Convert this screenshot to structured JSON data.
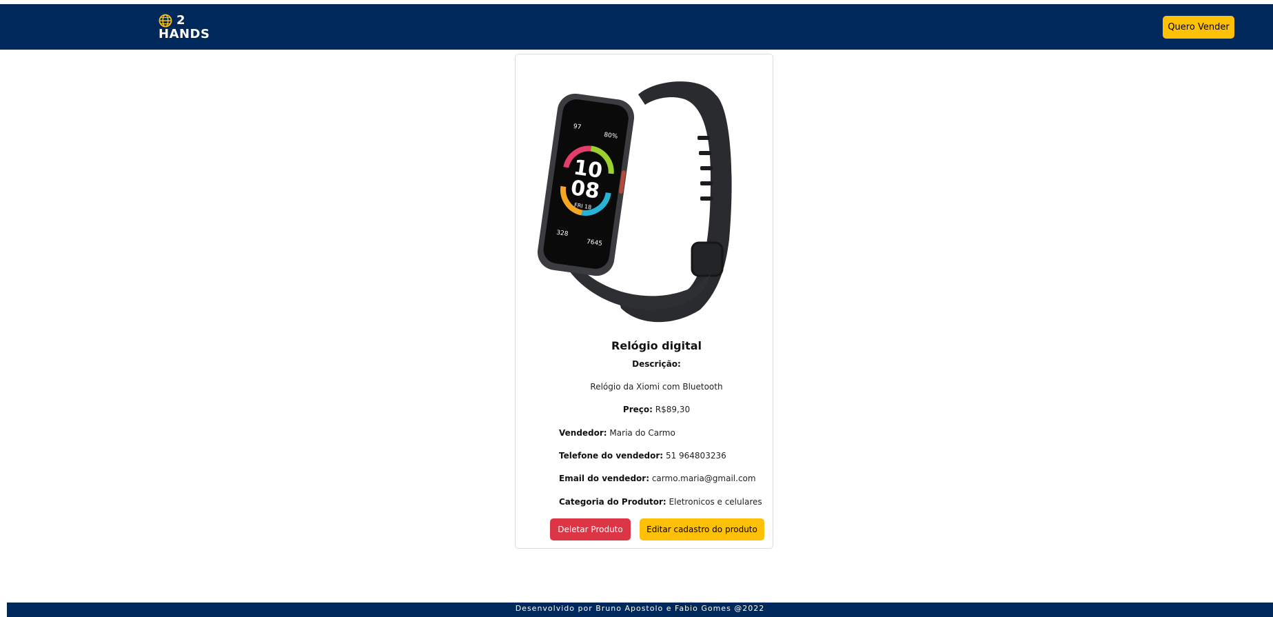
{
  "header": {
    "logo_number": "2",
    "logo_text": "HANDS",
    "sell_button_label": "Quero Vender"
  },
  "product": {
    "image_icon": "smartwatch-band-image",
    "title": "Relógio digital",
    "description_label": "Descrição:",
    "description": "Relógio da Xiomi com Bluetooth",
    "price_label": "Preço:",
    "price": "R$89,30",
    "seller_label": "Vendedor:",
    "seller": "Maria do Carmo",
    "phone_label": "Telefone do vendedor:",
    "phone": "51 964803236",
    "email_label": "Email do vendedor:",
    "email": "carmo.maria@gmail.com",
    "category_label": "Categoria do Produtor:",
    "category": "Eletronicos e celulares",
    "watch_display": {
      "heart_rate": "97",
      "battery": "80%",
      "hour": "10",
      "minute": "08",
      "date": "FRI 18",
      "calories": "328",
      "steps": "7645"
    }
  },
  "actions": {
    "delete_label": "Deletar Produto",
    "edit_label": "Editar cadastro do produto"
  },
  "footer": {
    "text": "Desenvolvido por Bruno Apostolo e Fabio Gomes @2022"
  },
  "colors": {
    "navbar": "#00285a",
    "warning": "#ffc107",
    "danger": "#dc3545"
  }
}
